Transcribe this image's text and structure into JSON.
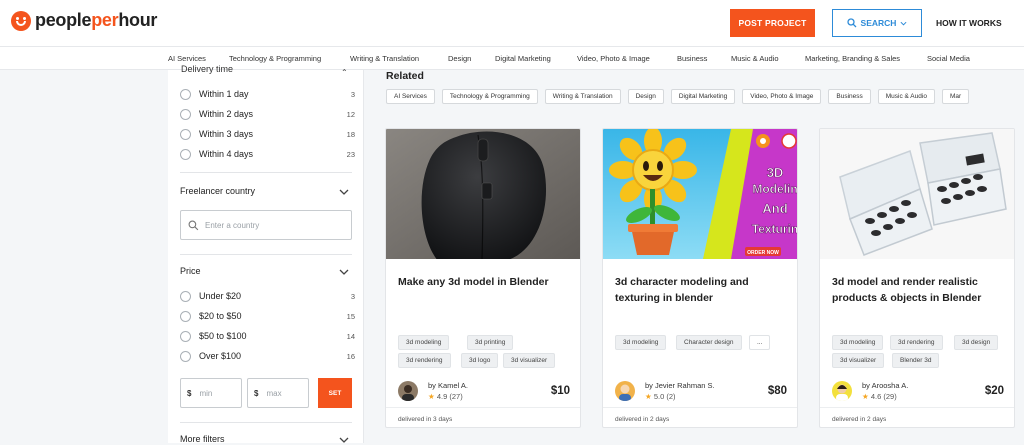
{
  "header": {
    "logo": {
      "part1": "people",
      "part2": "per",
      "part3": "hour"
    },
    "post_project": "POST PROJECT",
    "search": "SEARCH",
    "how_it_works": "HOW IT WORKS"
  },
  "categories": [
    "AI Services",
    "Technology & Programming",
    "Writing & Translation",
    "Design",
    "Digital Marketing",
    "Video, Photo & Image",
    "Business",
    "Music & Audio",
    "Marketing, Branding & Sales",
    "Social Media"
  ],
  "sidebar": {
    "delivery_title": "Delivery time",
    "delivery_options": [
      {
        "label": "Within 1 day",
        "count": "3"
      },
      {
        "label": "Within 2 days",
        "count": "12"
      },
      {
        "label": "Within 3 days",
        "count": "18"
      },
      {
        "label": "Within 4 days",
        "count": "23"
      }
    ],
    "country_title": "Freelancer country",
    "country_placeholder": "Enter a country",
    "price_title": "Price",
    "price_options": [
      {
        "label": "Under $20",
        "count": "3"
      },
      {
        "label": "$20 to $50",
        "count": "15"
      },
      {
        "label": "$50 to $100",
        "count": "14"
      },
      {
        "label": "Over $100",
        "count": "16"
      }
    ],
    "currency": "$",
    "min_placeholder": "min",
    "max_placeholder": "max",
    "set_label": "SET",
    "more_filters": "More filters"
  },
  "related": {
    "title": "Related",
    "tags": [
      "AI Services",
      "Technology & Programming",
      "Writing & Translation",
      "Design",
      "Digital Marketing",
      "Video, Photo & Image",
      "Business",
      "Music & Audio",
      "Mar"
    ]
  },
  "cards": [
    {
      "title": "Make any 3d model in Blender",
      "tags": [
        "3d modeling",
        "3d printing",
        "3d rendering",
        "3d logo",
        "3d visualizer"
      ],
      "seller": "by Kamel A.",
      "rating": "4.9",
      "reviews": "(27)",
      "price": "$10",
      "delivery": "delivered in 3 days"
    },
    {
      "title": "3d character modeling and texturing in blender",
      "tags": [
        "3d modeling",
        "Character design",
        "..."
      ],
      "seller": "by Jevier Rahman S.",
      "rating": "5.0",
      "reviews": "(2)",
      "price": "$80",
      "delivery": "delivered in 2 days",
      "banner": [
        "3D",
        "Modelin",
        "And",
        "Texturin"
      ],
      "banner_button": "ORDER NOW"
    },
    {
      "title": "3d model and render realistic products & objects in Blender",
      "tags": [
        "3d modeling",
        "3d rendering",
        "3d design",
        "3d visualizer",
        "Blender 3d"
      ],
      "seller": "by Aroosha A.",
      "rating": "4.6",
      "reviews": "(29)",
      "price": "$20",
      "delivery": "delivered in 2 days"
    }
  ],
  "colors": {
    "brand": "#f4541d",
    "accent": "#2d8bd8",
    "star": "#f5a623"
  }
}
